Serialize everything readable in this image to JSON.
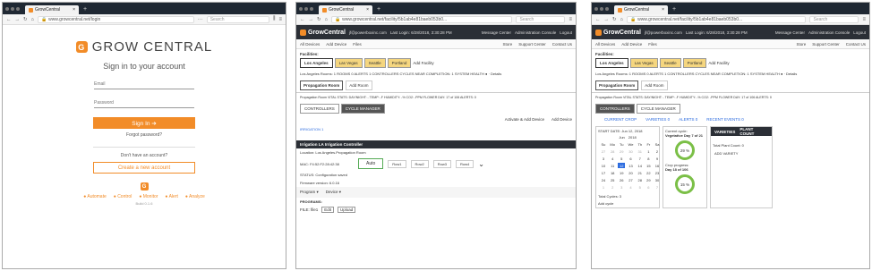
{
  "windows": [
    {
      "tab_title": "GrowCentral",
      "url": "www.growcentral.net/login",
      "search_placeholder": "Search"
    },
    {
      "tab_title": "GrowCentral",
      "url": "www.growcentral.net/facility/5b1ab4e81baeb053b0...",
      "search_placeholder": "Search"
    },
    {
      "tab_title": "GrowCentral",
      "url": "www.growcentral.net/facility/5b1ab4e81baeb053b0...",
      "search_placeholder": "Search"
    }
  ],
  "login": {
    "brand": "GROW CENTRAL",
    "heading": "Sign in to your account",
    "email_label": "Email",
    "password_label": "Password",
    "signin_label": "Sign In ➔",
    "forgot": "Forgot password?",
    "no_account": "Don't have an account?",
    "create": "Create a new account",
    "features": [
      "Automate",
      "Control",
      "Monitor",
      "Alert",
      "Analyze"
    ],
    "version": "Build 0.1.6"
  },
  "dash": {
    "brand": "GrowCentral",
    "user": "jf@powerboxinc.com",
    "last_login": "Last Login: 6/28/2018, 3:30:28 PM",
    "message_center": "Message Center",
    "admin": "Administration Console",
    "logout": "Logout",
    "all_devices": "All Devices",
    "add_device": "Add Device",
    "files": "Files",
    "store": "Store",
    "support": "Support Center",
    "contact": "Contact Us",
    "facilities_label": "Facilities:",
    "facilities": [
      "Los Angeles",
      "Las Vegas",
      "Seattle",
      "Portland"
    ],
    "add_facility": "Add Facility",
    "info": "Los Angeles  Rooms: 1 ROOMS  0 ALERTS  1 CONTROLLERS  CYCLES NEAR COMPLETION: 1  SYSTEM HEALTH ● · Details",
    "room_tab": "Propagation Room",
    "add_room": "Add Room",
    "stats": "Propagation Room  VITAL STATS:  DAY/NIGHT: -  TEMP: -F  HUMIDITY: -%  CO2: -PPM  FLOWER DAY: 17 of 106  ALERTS: 0",
    "controllers_tab": "CONTROLLERS",
    "cycle_tab": "CYCLE MANAGER"
  },
  "panel2": {
    "activate": "Activate & Add Device",
    "add_device": "Add Device",
    "irrigation_link": "IRRIGATION 1",
    "bar_title": "Irrigation LA  Irrigation Controller",
    "location": "Location: Los Angeles.Propagation Room",
    "mac": "MAC: F4:52:F2:28:42:38",
    "status": "STATUS: Configuration saved",
    "firmware": "Firmware version: 6.0.16",
    "auto": "Auto",
    "rows": [
      "Row1",
      "Row2",
      "Row3",
      "Row4"
    ],
    "program": "Program ▾",
    "device": "Device ▾",
    "programs": "PROGRAMS:",
    "file": "FILE:  file1",
    "edit": "Edit",
    "upload": "Upload"
  },
  "panel3": {
    "current_crop": "CURRENT CROP",
    "varieties": "VARIETIES 0",
    "alerts": "ALERTS 0",
    "recent_events": "RECENT EVENTS 0",
    "start_date": "START DATE: Jun 12, 2018",
    "month": "Jun",
    "year": "2018",
    "weekdays": [
      "Su",
      "Mo",
      "Tu",
      "We",
      "Th",
      "Fr",
      "Sa"
    ],
    "days": [
      [
        "27",
        "28",
        "29",
        "30",
        "31",
        "1",
        "2"
      ],
      [
        "3",
        "4",
        "5",
        "6",
        "7",
        "8",
        "9"
      ],
      [
        "10",
        "11",
        "12",
        "13",
        "14",
        "15",
        "16"
      ],
      [
        "17",
        "18",
        "19",
        "20",
        "21",
        "22",
        "23"
      ],
      [
        "24",
        "25",
        "26",
        "27",
        "28",
        "29",
        "30"
      ],
      [
        "1",
        "2",
        "3",
        "4",
        "5",
        "6",
        "7"
      ]
    ],
    "total_cycles": "Total Cycles: 3",
    "add_cycle": "Add cycle",
    "current_cycle": "Current cycle:",
    "veg_day": "Vegetative Day 7 of 21",
    "ring1": "29 %",
    "crop_progress": "Crop progress:",
    "day18": "Day 18 of 106",
    "ring2": "15 %",
    "varieties_head": "VARIETIES",
    "plant_count_head": "PLANT COUNT",
    "total_plant": "Total Plant Count:  0",
    "add_variety": "ADD VARIETY"
  }
}
